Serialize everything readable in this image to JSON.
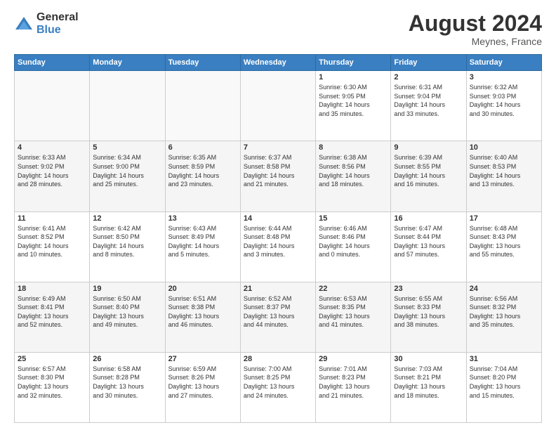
{
  "header": {
    "logo_general": "General",
    "logo_blue": "Blue",
    "month_title": "August 2024",
    "location": "Meynes, France"
  },
  "weekdays": [
    "Sunday",
    "Monday",
    "Tuesday",
    "Wednesday",
    "Thursday",
    "Friday",
    "Saturday"
  ],
  "weeks": [
    [
      {
        "day": "",
        "info": ""
      },
      {
        "day": "",
        "info": ""
      },
      {
        "day": "",
        "info": ""
      },
      {
        "day": "",
        "info": ""
      },
      {
        "day": "1",
        "info": "Sunrise: 6:30 AM\nSunset: 9:05 PM\nDaylight: 14 hours\nand 35 minutes."
      },
      {
        "day": "2",
        "info": "Sunrise: 6:31 AM\nSunset: 9:04 PM\nDaylight: 14 hours\nand 33 minutes."
      },
      {
        "day": "3",
        "info": "Sunrise: 6:32 AM\nSunset: 9:03 PM\nDaylight: 14 hours\nand 30 minutes."
      }
    ],
    [
      {
        "day": "4",
        "info": "Sunrise: 6:33 AM\nSunset: 9:02 PM\nDaylight: 14 hours\nand 28 minutes."
      },
      {
        "day": "5",
        "info": "Sunrise: 6:34 AM\nSunset: 9:00 PM\nDaylight: 14 hours\nand 25 minutes."
      },
      {
        "day": "6",
        "info": "Sunrise: 6:35 AM\nSunset: 8:59 PM\nDaylight: 14 hours\nand 23 minutes."
      },
      {
        "day": "7",
        "info": "Sunrise: 6:37 AM\nSunset: 8:58 PM\nDaylight: 14 hours\nand 21 minutes."
      },
      {
        "day": "8",
        "info": "Sunrise: 6:38 AM\nSunset: 8:56 PM\nDaylight: 14 hours\nand 18 minutes."
      },
      {
        "day": "9",
        "info": "Sunrise: 6:39 AM\nSunset: 8:55 PM\nDaylight: 14 hours\nand 16 minutes."
      },
      {
        "day": "10",
        "info": "Sunrise: 6:40 AM\nSunset: 8:53 PM\nDaylight: 14 hours\nand 13 minutes."
      }
    ],
    [
      {
        "day": "11",
        "info": "Sunrise: 6:41 AM\nSunset: 8:52 PM\nDaylight: 14 hours\nand 10 minutes."
      },
      {
        "day": "12",
        "info": "Sunrise: 6:42 AM\nSunset: 8:50 PM\nDaylight: 14 hours\nand 8 minutes."
      },
      {
        "day": "13",
        "info": "Sunrise: 6:43 AM\nSunset: 8:49 PM\nDaylight: 14 hours\nand 5 minutes."
      },
      {
        "day": "14",
        "info": "Sunrise: 6:44 AM\nSunset: 8:48 PM\nDaylight: 14 hours\nand 3 minutes."
      },
      {
        "day": "15",
        "info": "Sunrise: 6:46 AM\nSunset: 8:46 PM\nDaylight: 14 hours\nand 0 minutes."
      },
      {
        "day": "16",
        "info": "Sunrise: 6:47 AM\nSunset: 8:44 PM\nDaylight: 13 hours\nand 57 minutes."
      },
      {
        "day": "17",
        "info": "Sunrise: 6:48 AM\nSunset: 8:43 PM\nDaylight: 13 hours\nand 55 minutes."
      }
    ],
    [
      {
        "day": "18",
        "info": "Sunrise: 6:49 AM\nSunset: 8:41 PM\nDaylight: 13 hours\nand 52 minutes."
      },
      {
        "day": "19",
        "info": "Sunrise: 6:50 AM\nSunset: 8:40 PM\nDaylight: 13 hours\nand 49 minutes."
      },
      {
        "day": "20",
        "info": "Sunrise: 6:51 AM\nSunset: 8:38 PM\nDaylight: 13 hours\nand 46 minutes."
      },
      {
        "day": "21",
        "info": "Sunrise: 6:52 AM\nSunset: 8:37 PM\nDaylight: 13 hours\nand 44 minutes."
      },
      {
        "day": "22",
        "info": "Sunrise: 6:53 AM\nSunset: 8:35 PM\nDaylight: 13 hours\nand 41 minutes."
      },
      {
        "day": "23",
        "info": "Sunrise: 6:55 AM\nSunset: 8:33 PM\nDaylight: 13 hours\nand 38 minutes."
      },
      {
        "day": "24",
        "info": "Sunrise: 6:56 AM\nSunset: 8:32 PM\nDaylight: 13 hours\nand 35 minutes."
      }
    ],
    [
      {
        "day": "25",
        "info": "Sunrise: 6:57 AM\nSunset: 8:30 PM\nDaylight: 13 hours\nand 32 minutes."
      },
      {
        "day": "26",
        "info": "Sunrise: 6:58 AM\nSunset: 8:28 PM\nDaylight: 13 hours\nand 30 minutes."
      },
      {
        "day": "27",
        "info": "Sunrise: 6:59 AM\nSunset: 8:26 PM\nDaylight: 13 hours\nand 27 minutes."
      },
      {
        "day": "28",
        "info": "Sunrise: 7:00 AM\nSunset: 8:25 PM\nDaylight: 13 hours\nand 24 minutes."
      },
      {
        "day": "29",
        "info": "Sunrise: 7:01 AM\nSunset: 8:23 PM\nDaylight: 13 hours\nand 21 minutes."
      },
      {
        "day": "30",
        "info": "Sunrise: 7:03 AM\nSunset: 8:21 PM\nDaylight: 13 hours\nand 18 minutes."
      },
      {
        "day": "31",
        "info": "Sunrise: 7:04 AM\nSunset: 8:20 PM\nDaylight: 13 hours\nand 15 minutes."
      }
    ]
  ]
}
